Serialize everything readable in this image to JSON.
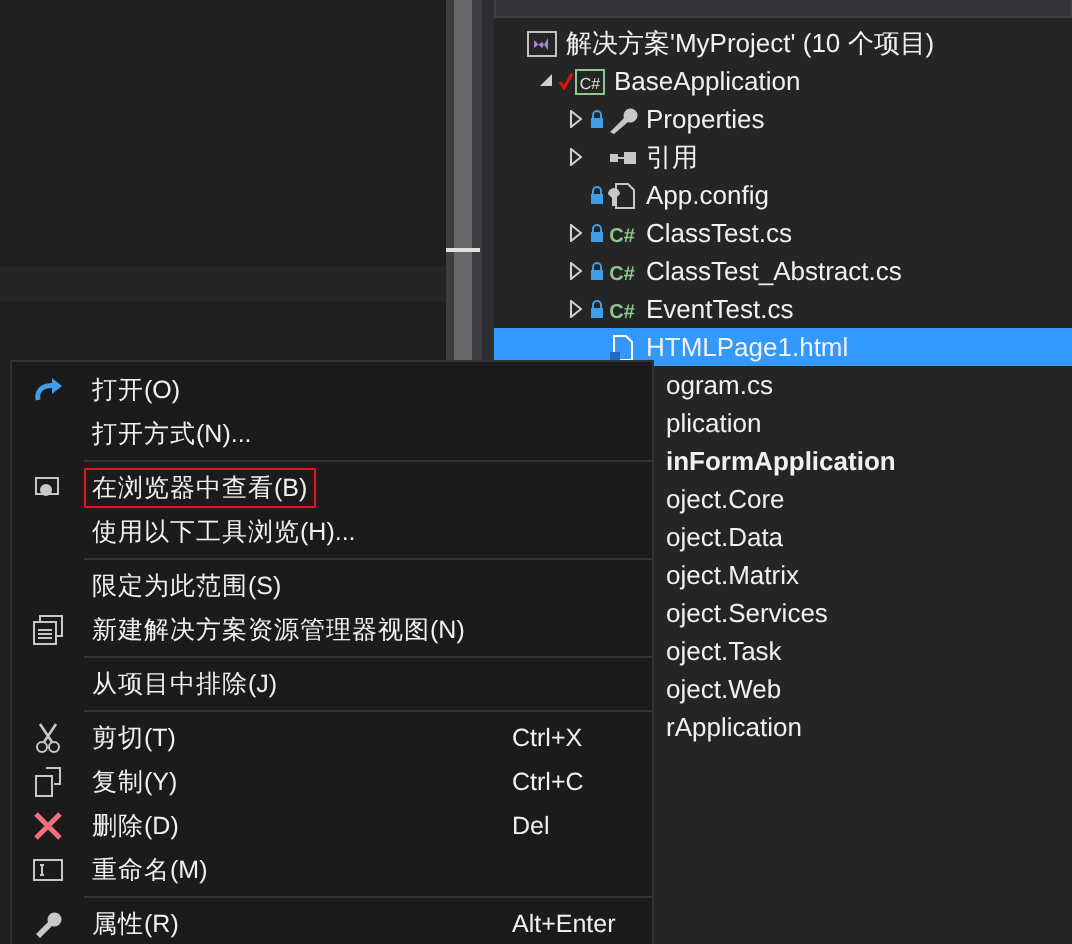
{
  "solution_explorer": {
    "tree": [
      {
        "label": "解决方案'MyProject' (10 个项目)",
        "kind": "solution",
        "selected": false,
        "children": [
          {
            "label": "BaseApplication",
            "kind": "project",
            "icon_text": "C#",
            "expanded": true,
            "selected": false,
            "checked_out": true,
            "children": [
              {
                "label": "Properties",
                "kind": "properties",
                "expanded": false,
                "selected": false,
                "locked": true
              },
              {
                "label": "引用",
                "kind": "references",
                "expanded": false,
                "selected": false,
                "locked": false
              },
              {
                "label": "App.config",
                "kind": "config",
                "selected": false,
                "locked": true
              },
              {
                "label": "ClassTest.cs",
                "kind": "code",
                "icon_text": "C#",
                "expanded": false,
                "selected": false,
                "locked": true
              },
              {
                "label": "ClassTest_Abstract.cs",
                "kind": "code",
                "icon_text": "C#",
                "expanded": false,
                "selected": false,
                "locked": true
              },
              {
                "label": "EventTest.cs",
                "kind": "code",
                "icon_text": "C#",
                "expanded": false,
                "selected": false,
                "locked": true
              },
              {
                "label": "HTMLPage1.html",
                "kind": "html",
                "selected": true,
                "locked": false
              }
            ]
          }
        ]
      }
    ],
    "covered_rows": [
      {
        "label": "ogram.cs",
        "bold": false
      },
      {
        "label": "plication",
        "bold": false
      },
      {
        "label": "inFormApplication",
        "bold": true
      },
      {
        "label": "oject.Core",
        "bold": false
      },
      {
        "label": "oject.Data",
        "bold": false
      },
      {
        "label": "oject.Matrix",
        "bold": false
      },
      {
        "label": "oject.Services",
        "bold": false
      },
      {
        "label": "oject.Task",
        "bold": false
      },
      {
        "label": "oject.Web",
        "bold": false
      },
      {
        "label": "rApplication",
        "bold": false
      }
    ]
  },
  "context_menu": [
    {
      "kind": "item",
      "label": "打开(O)"
    },
    {
      "kind": "item",
      "label": "打开方式(N)..."
    },
    {
      "kind": "separator"
    },
    {
      "kind": "item",
      "label": "在浏览器中查看(B)",
      "annotated": true
    },
    {
      "kind": "item",
      "label": "使用以下工具浏览(H)..."
    },
    {
      "kind": "separator"
    },
    {
      "kind": "item",
      "label": "限定为此范围(S)"
    },
    {
      "kind": "item",
      "label": "新建解决方案资源管理器视图(N)"
    },
    {
      "kind": "separator"
    },
    {
      "kind": "item",
      "label": "从项目中排除(J)"
    },
    {
      "kind": "separator"
    },
    {
      "kind": "item",
      "label": "剪切(T)",
      "shortcut": "Ctrl+X"
    },
    {
      "kind": "item",
      "label": "复制(Y)",
      "shortcut": "Ctrl+C"
    },
    {
      "kind": "item",
      "label": "删除(D)",
      "shortcut": "Del"
    },
    {
      "kind": "item",
      "label": "重命名(M)"
    },
    {
      "kind": "separator"
    },
    {
      "kind": "item",
      "label": "属性(R)",
      "shortcut": "Alt+Enter"
    }
  ]
}
